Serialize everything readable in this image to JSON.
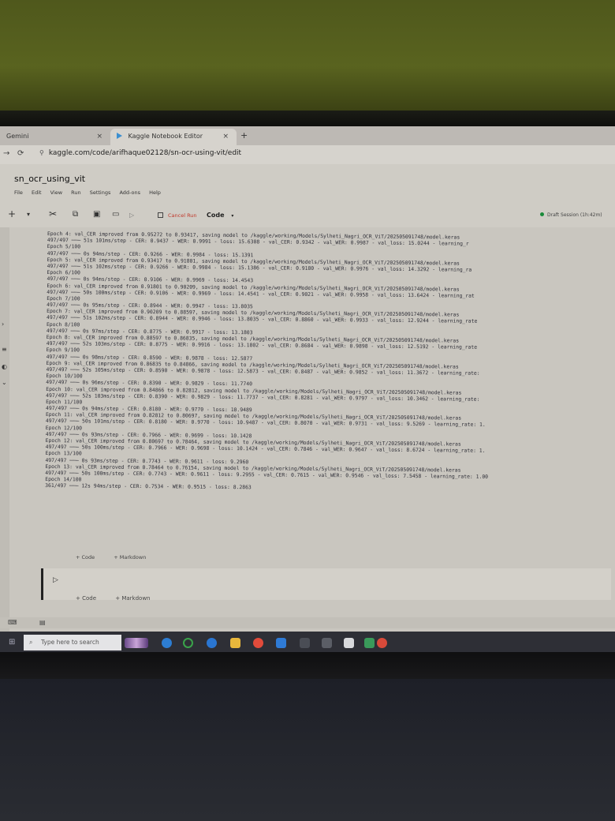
{
  "browser": {
    "tabs": [
      {
        "label": "Gemini"
      },
      {
        "label": "Kaggle Notebook Editor"
      }
    ],
    "new_tab": "+",
    "close_glyph": "×",
    "url": "kaggle.com/code/arifhaque02128/sn-ocr-using-vit/edit"
  },
  "notebook": {
    "title": "sn_ocr_using_vit",
    "menu": [
      "File",
      "Edit",
      "View",
      "Run",
      "Settings",
      "Add-ons",
      "Help"
    ],
    "toolbar": {
      "cancel_run": "Cancel Run",
      "cell_type": "Code",
      "session": "Draft Session (1h:42m)"
    },
    "output_lines": [
      "Epoch 4: val_CER improved from 0.95272 to 0.93417, saving model to /kaggle/working/Models/Sylheti_Nagri_OCR_ViT/202505091748/model.keras",
      "497/497 ─── 51s 101ms/step - CER: 0.9437 - WER: 0.9991 - loss: 15.6308 - val_CER: 0.9342 - val_WER: 0.9987 - val_loss: 15.0244 - learning_r",
      "Epoch 5/100",
      "497/497 ─── 0s 94ms/step - CER: 0.9266 - WER: 0.9984 - loss: 15.1391",
      "Epoch 5: val_CER improved from 0.93417 to 0.91801, saving model to /kaggle/working/Models/Sylheti_Nagri_OCR_ViT/202505091748/model.keras",
      "497/497 ─── 51s 102ms/step - CER: 0.9266 - WER: 0.9984 - loss: 15.1386 - val_CER: 0.9180 - val_WER: 0.9976 - val_loss: 14.3292 - learning_ra",
      "Epoch 6/100",
      "497/497 ─── 0s 94ms/step - CER: 0.9106 - WER: 0.9969 - loss: 14.4543",
      "Epoch 6: val_CER improved from 0.91801 to 0.90209, saving model to /kaggle/working/Models/Sylheti_Nagri_OCR_ViT/202505091748/model.keras",
      "497/497 ─── 50s 100ms/step - CER: 0.9106 - WER: 0.9969 - loss: 14.4541 - val_CER: 0.9021 - val_WER: 0.9958 - val_loss: 13.6424 - learning_rat",
      "Epoch 7/100",
      "497/497 ─── 0s 95ms/step - CER: 0.8944 - WER: 0.9947 - loss: 13.8035",
      "Epoch 7: val_CER improved from 0.90209 to 0.88597, saving model to /kaggle/working/Models/Sylheti_Nagri_OCR_ViT/202505091748/model.keras",
      "497/497 ─── 51s 102ms/step - CER: 0.8944 - WER: 0.9946 - loss: 13.8035 - val_CER: 0.8860 - val_WER: 0.9933 - val_loss: 12.9244 - learning_rate",
      "Epoch 8/100",
      "497/497 ─── 0s 97ms/step - CER: 0.8775 - WER: 0.9917 - loss: 13.1803",
      "Epoch 8: val_CER improved from 0.88597 to 0.86835, saving model to /kaggle/working/Models/Sylheti_Nagri_OCR_ViT/202505091748/model.keras",
      "497/497 ─── 52s 103ms/step - CER: 0.8775 - WER: 0.9916 - loss: 13.1802 - val_CER: 0.8684 - val_WER: 0.9898 - val_loss: 12.5192 - learning_rate",
      "Epoch 9/100",
      "497/497 ─── 0s 98ms/step - CER: 0.8590 - WER: 0.9878 - loss: 12.5877",
      "Epoch 9: val_CER improved from 0.86835 to 0.84866, saving model to /kaggle/working/Models/Sylheti_Nagri_OCR_ViT/202505091748/model.keras",
      "497/497 ─── 52s 105ms/step - CER: 0.8590 - WER: 0.9878 - loss: 12.5873 - val_CER: 0.8487 - val_WER: 0.9852 - val_loss: 11.3672 - learning_rate:",
      "Epoch 10/100",
      "497/497 ─── 0s 96ms/step - CER: 0.8390 - WER: 0.9829 - loss: 11.7740",
      "Epoch 10: val_CER improved from 0.84866 to 0.82812, saving model to /kaggle/working/Models/Sylheti_Nagri_OCR_ViT/202505091748/model.keras",
      "497/497 ─── 52s 103ms/step - CER: 0.8390 - WER: 0.9829 - loss: 11.7737 - val_CER: 0.8281 - val_WER: 0.9797 - val_loss: 10.3462 - learning_rate:",
      "Epoch 11/100",
      "497/497 ─── 0s 94ms/step - CER: 0.8180 - WER: 0.9770 - loss: 10.9489",
      "Epoch 11: val_CER improved from 0.82812 to 0.80697, saving model to /kaggle/working/Models/Sylheti_Nagri_OCR_ViT/202505091748/model.keras",
      "497/497 ─── 50s 101ms/step - CER: 0.8180 - WER: 0.9770 - loss: 10.9487 - val_CER: 0.8070 - val_WER: 0.9731 - val_loss: 9.5269 - learning_rate: 1.",
      "Epoch 12/100",
      "497/497 ─── 0s 93ms/step - CER: 0.7966 - WER: 0.9699 - loss: 10.1428",
      "Epoch 12: val_CER improved from 0.80697 to 0.78464, saving model to /kaggle/working/Models/Sylheti_Nagri_OCR_ViT/202505091748/model.keras",
      "497/497 ─── 50s 100ms/step - CER: 0.7966 - WER: 0.9698 - loss: 10.1424 - val_CER: 0.7846 - val_WER: 0.9647 - val_loss: 8.6724 - learning_rate: 1.",
      "Epoch 13/100",
      "497/497 ─── 0s 93ms/step - CER: 0.7743 - WER: 0.9611 - loss: 9.2960",
      "Epoch 13: val_CER improved from 0.78464 to 0.76154, saving model to /kaggle/working/Models/Sylheti_Nagri_OCR_ViT/202505091748/model.keras",
      "497/497 ─── 50s 100ms/step - CER: 0.7743 - WER: 0.9611 - loss: 9.2955 - val_CER: 0.7615 - val_WER: 0.9546 - val_loss: 7.5458 - learning_rate: 1.00",
      "Epoch 14/100",
      "361/497 ─── 12s 94ms/step - CER: 0.7534 - WER: 0.9515 - loss: 8.2863"
    ],
    "add_code": "+ Code",
    "add_markdown": "+ Markdown"
  },
  "taskbar": {
    "search_placeholder": "Type here to search",
    "icons": [
      "zoom-icon",
      "edge-icon",
      "chrome-icon",
      "vscode-icon",
      "folder-icon"
    ]
  }
}
